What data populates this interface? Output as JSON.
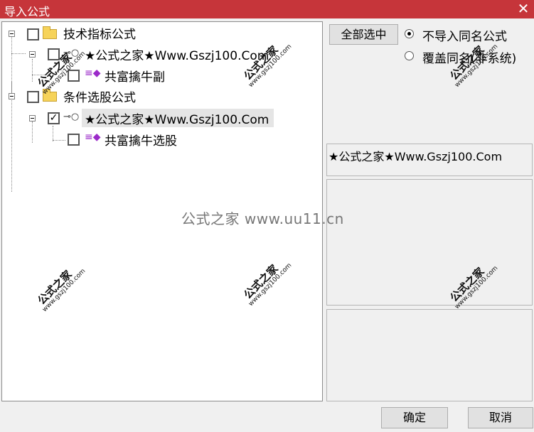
{
  "window": {
    "title": "导入公式",
    "close_icon": "close-icon"
  },
  "tree": {
    "group1_label": "技术指标公式",
    "group1_child_label": "★公式之家★Www.Gszj100.Com",
    "group1_leaf_label": "共富擒牛副",
    "group2_label": "条件选股公式",
    "group2_child_label": "★公式之家★Www.Gszj100.Com",
    "group2_leaf_label": "共富擒牛选股",
    "check_mark": "✓"
  },
  "options": {
    "select_all": "全部选中",
    "radio_no_import": "不导入同名公式",
    "radio_overwrite": "覆盖同名(非系统)"
  },
  "info": {
    "selected_text": "★公式之家★Www.Gszj100.Com"
  },
  "footer": {
    "ok": "确定",
    "cancel": "取消"
  },
  "watermark": {
    "site_name": "公式之家",
    "site_url": "www.gszj100.com",
    "center_text": "公式之家 www.uu11.cn"
  },
  "colors": {
    "title_bar": "#c6353a",
    "gem": "#9b2ac9",
    "folder": "#f6d35a"
  }
}
